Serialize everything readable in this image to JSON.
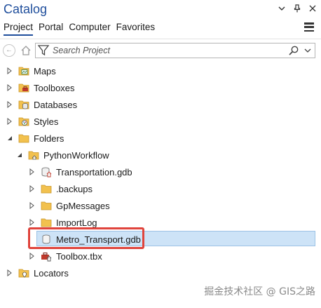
{
  "pane": {
    "title": "Catalog",
    "controls": [
      "chevron-down",
      "pin",
      "close"
    ]
  },
  "tabs": [
    {
      "label": "Project",
      "active": true
    },
    {
      "label": "Portal",
      "active": false
    },
    {
      "label": "Computer",
      "active": false
    },
    {
      "label": "Favorites",
      "active": false
    }
  ],
  "search": {
    "placeholder": "Search Project"
  },
  "tree": {
    "items": [
      {
        "label": "Maps",
        "icon": "maps-folder-icon",
        "expanded": false
      },
      {
        "label": "Toolboxes",
        "icon": "toolboxes-folder-icon",
        "expanded": false
      },
      {
        "label": "Databases",
        "icon": "databases-folder-icon",
        "expanded": false
      },
      {
        "label": "Styles",
        "icon": "styles-folder-icon",
        "expanded": false
      },
      {
        "label": "Folders",
        "icon": "folders-icon",
        "expanded": true
      },
      {
        "label": "PythonWorkflow",
        "icon": "project-folder-icon",
        "expanded": true
      },
      {
        "label": "Transportation.gdb",
        "icon": "geodatabase-icon",
        "expanded": false
      },
      {
        "label": ".backups",
        "icon": "folder-icon",
        "expanded": false
      },
      {
        "label": "GpMessages",
        "icon": "folder-icon",
        "expanded": false
      },
      {
        "label": "ImportLog",
        "icon": "folder-icon",
        "expanded": false
      },
      {
        "label": "Metro_Transport.gdb",
        "icon": "geodatabase-icon",
        "expanded": false,
        "selected": true
      },
      {
        "label": "Toolbox.tbx",
        "icon": "toolbox-icon",
        "expanded": false
      },
      {
        "label": "Locators",
        "icon": "locators-folder-icon",
        "expanded": false
      }
    ]
  },
  "watermark": "掘金技术社区 @ GIS之路",
  "colors": {
    "accent": "#1f4e9c",
    "selection": "#cde3f7",
    "highlight": "#e0443c",
    "folder": "#f2c14e"
  }
}
